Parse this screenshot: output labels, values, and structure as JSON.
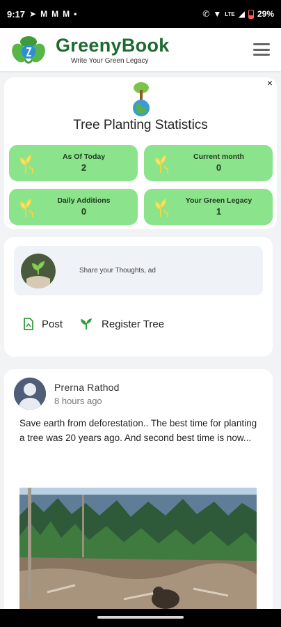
{
  "status_bar": {
    "time": "9:17",
    "battery": "29%",
    "network": "LTE"
  },
  "header": {
    "brand": "GreenyBook",
    "tagline": "Write Your Green Legacy"
  },
  "stats": {
    "title": "Tree Planting Statistics",
    "close": "×",
    "tiles": [
      {
        "label": "As Of Today",
        "value": "2"
      },
      {
        "label": "Current month",
        "value": "0"
      },
      {
        "label": "Daily Additions",
        "value": "0"
      },
      {
        "label": "Your Green Legacy",
        "value": "1"
      }
    ]
  },
  "composer": {
    "placeholder": "Share your Thoughts, ad",
    "actions": {
      "post": "Post",
      "register": "Register Tree"
    }
  },
  "post": {
    "author": "Prerna Rathod",
    "time": "8 hours ago",
    "text": "Save earth from deforestation.. The best time for planting a tree was 20 years ago. And second best time is now..."
  },
  "colors": {
    "brand": "#1d6b2f",
    "tile": "#8be38c",
    "accent": "#2e9e3a"
  }
}
